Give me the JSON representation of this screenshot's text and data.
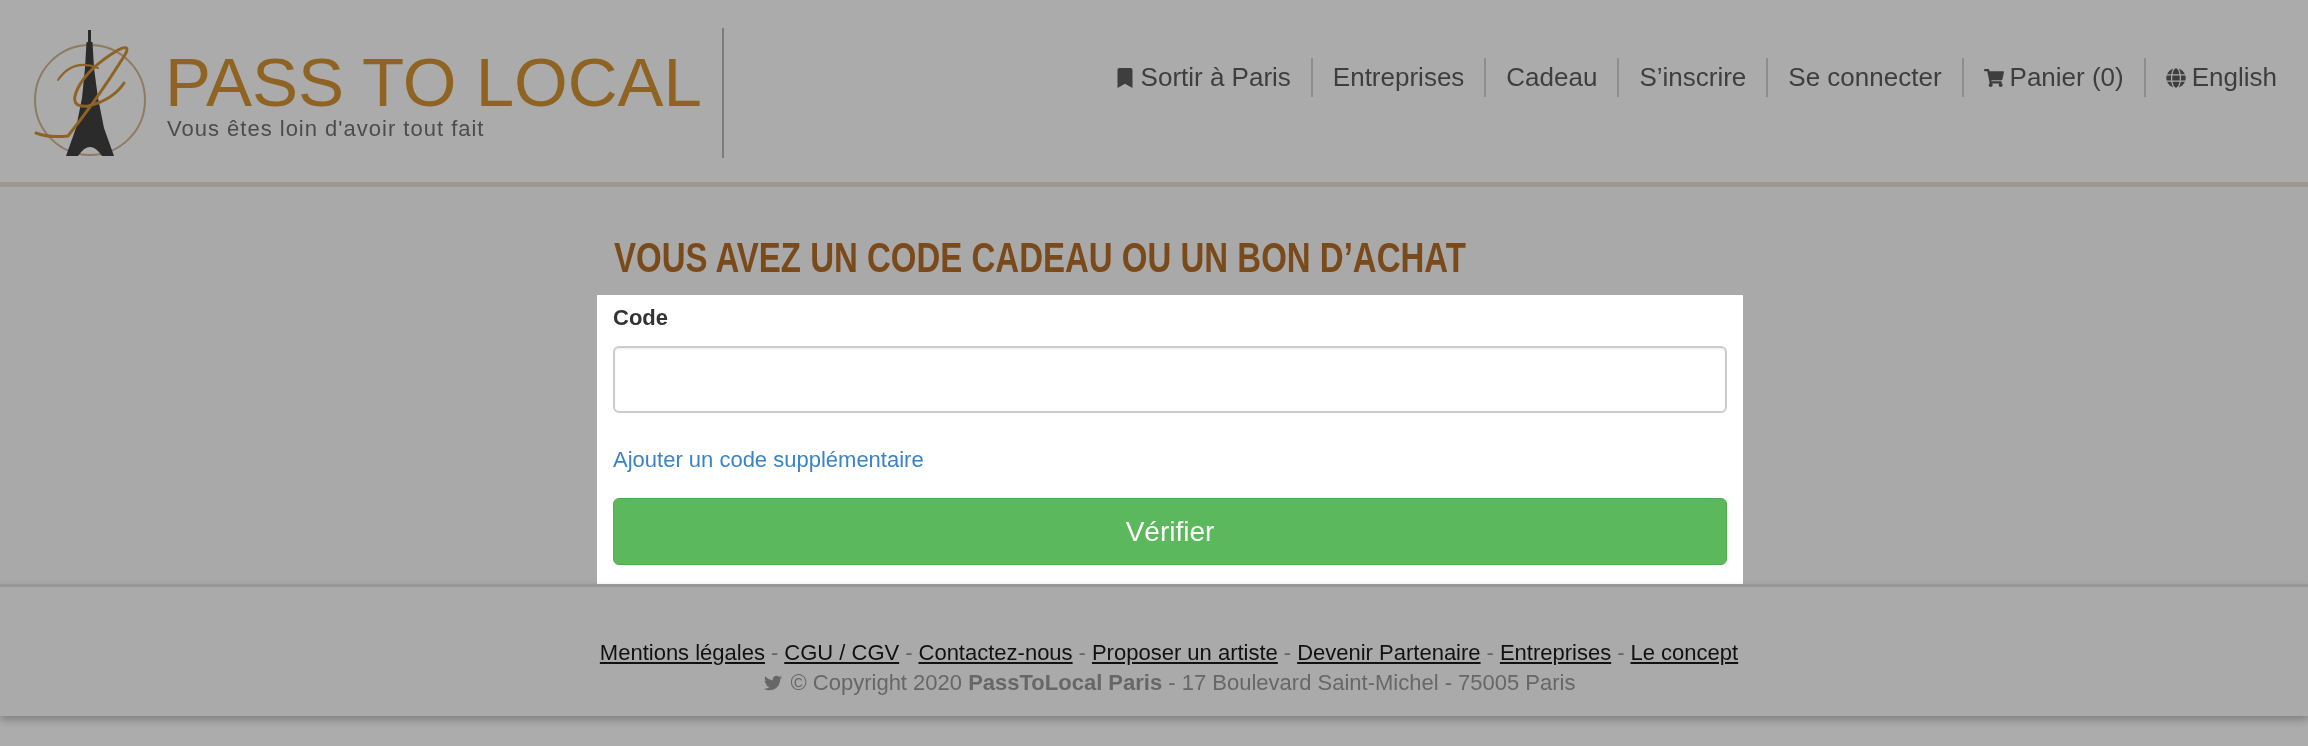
{
  "header": {
    "logo": {
      "title": "PASS TO LOCAL",
      "tagline": "Vous êtes loin d'avoir tout fait"
    },
    "nav": [
      {
        "label": "Sortir à Paris",
        "kind": "outings"
      },
      {
        "label": "Entreprises",
        "kind": "link"
      },
      {
        "label": "Cadeau",
        "kind": "link"
      },
      {
        "label": "S’inscrire",
        "kind": "link"
      },
      {
        "label": "Se connecter",
        "kind": "link"
      },
      {
        "label": "Panier (0)",
        "kind": "cart"
      },
      {
        "label": "English",
        "kind": "language"
      }
    ]
  },
  "gift_code": {
    "title": "VOUS AVEZ UN CODE CADEAU OU UN BON D’ACHAT",
    "code_field": {
      "label": "Code"
    },
    "add_code_link": "Ajouter un code supplémentaire",
    "submit_button": "Vérifier"
  },
  "footer": {
    "links": [
      "Mentions légales",
      "CGU / CGV",
      "Contactez-nous",
      "Proposer un artiste",
      "Devenir Partenaire",
      "Entreprises",
      "Le concept"
    ],
    "separator": "-",
    "copyright": "© Copyright 2020 **PassToLocal Paris** - 17 Boulevard Saint-Michel - 75005 Paris"
  }
}
